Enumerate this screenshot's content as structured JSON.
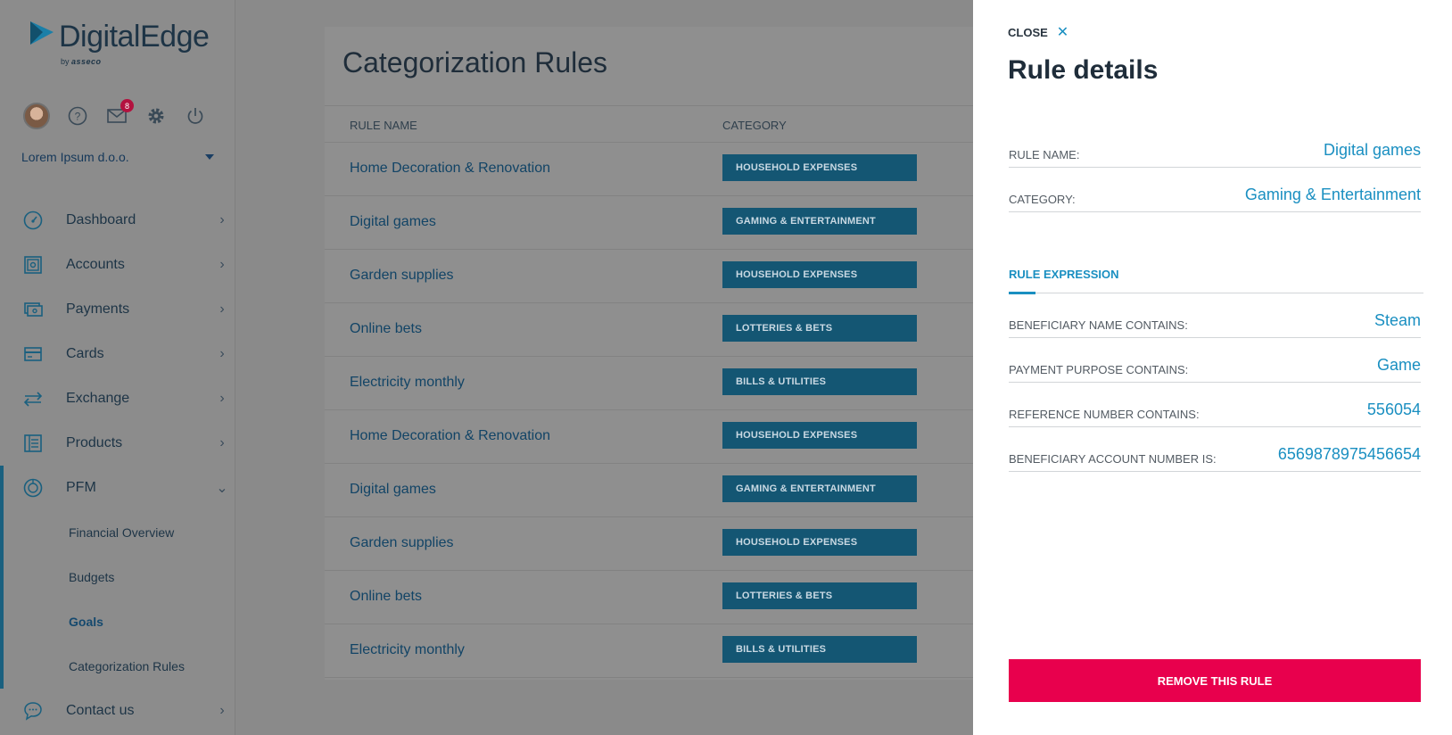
{
  "brand": {
    "name_part1": "Digital",
    "name_part2": "Edge",
    "by": "by",
    "sub": "asseco"
  },
  "user": {
    "notifications_count": "8",
    "company": "Lorem Ipsum d.o.o."
  },
  "nav": {
    "items": [
      {
        "label": "Dashboard",
        "icon": "gauge-icon"
      },
      {
        "label": "Accounts",
        "icon": "safe-icon"
      },
      {
        "label": "Payments",
        "icon": "payment-icon"
      },
      {
        "label": "Cards",
        "icon": "card-icon"
      },
      {
        "label": "Exchange",
        "icon": "exchange-icon"
      },
      {
        "label": "Products",
        "icon": "products-icon"
      },
      {
        "label": "PFM",
        "icon": "pfm-icon"
      }
    ],
    "pfm_sub": [
      "Financial Overview",
      "Budgets",
      "Goals",
      "Categorization Rules"
    ],
    "contact": "Contact us"
  },
  "main": {
    "title": "Categorization Rules",
    "columns": {
      "rule_name": "RULE NAME",
      "category": "CATEGORY"
    },
    "rows": [
      {
        "name": "Home Decoration & Renovation",
        "category": "HOUSEHOLD EXPENSES"
      },
      {
        "name": "Digital games",
        "category": "GAMING & ENTERTAINMENT"
      },
      {
        "name": "Garden supplies",
        "category": "HOUSEHOLD EXPENSES"
      },
      {
        "name": "Online bets",
        "category": "LOTTERIES & BETS"
      },
      {
        "name": "Electricity monthly",
        "category": "BILLS & UTILITIES"
      },
      {
        "name": "Home Decoration & Renovation",
        "category": "HOUSEHOLD EXPENSES"
      },
      {
        "name": "Digital games",
        "category": "GAMING & ENTERTAINMENT"
      },
      {
        "name": "Garden supplies",
        "category": "HOUSEHOLD EXPENSES"
      },
      {
        "name": "Online bets",
        "category": "LOTTERIES & BETS"
      },
      {
        "name": "Electricity monthly",
        "category": "BILLS & UTILITIES"
      }
    ]
  },
  "panel": {
    "close_label": "CLOSE",
    "close_glyph": "✕",
    "title": "Rule details",
    "rule_name_label": "RULE NAME:",
    "rule_name_value": "Digital games",
    "category_label": "CATEGORY:",
    "category_value": "Gaming & Entertainment",
    "tab_label": "RULE EXPRESSION",
    "expr": [
      {
        "label": "BENEFICIARY NAME CONTAINS:",
        "value": "Steam"
      },
      {
        "label": "PAYMENT PURPOSE CONTAINS:",
        "value": "Game"
      },
      {
        "label": "REFERENCE NUMBER CONTAINS:",
        "value": "556054"
      },
      {
        "label": "BENEFICIARY ACCOUNT NUMBER IS:",
        "value": "6569878975456654"
      }
    ],
    "remove_label": "REMOVE THIS RULE"
  },
  "colors": {
    "accent": "#1a8fc1",
    "category_badge": "#145673",
    "danger": "#e8004d"
  }
}
